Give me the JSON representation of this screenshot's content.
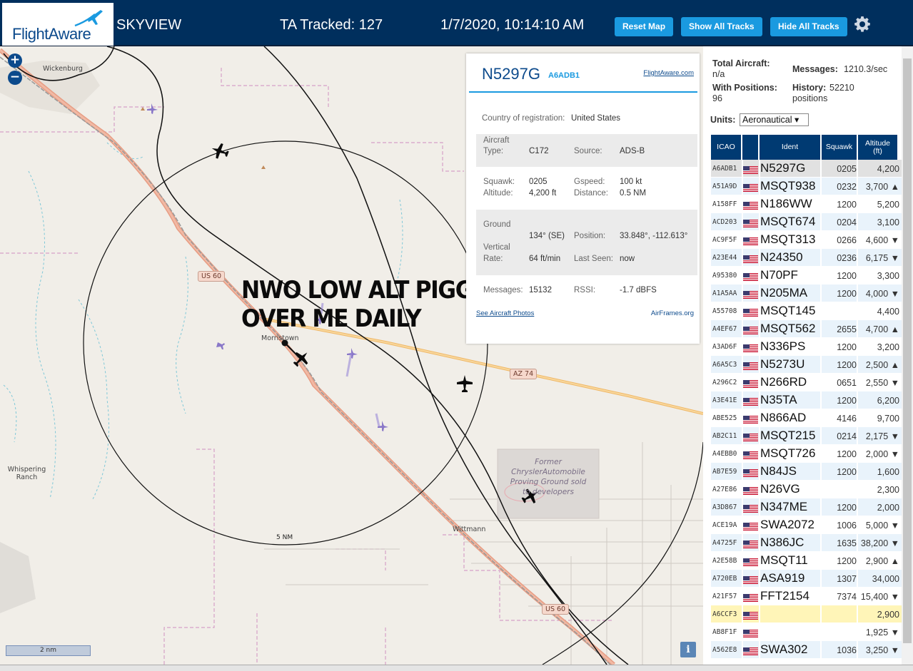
{
  "header": {
    "logo": "FlightAware",
    "site_title": "SKYVIEW",
    "tracked": "TA Tracked: 127",
    "datetime": "1/7/2020, 10:14:10 AM",
    "buttons": {
      "reset": "Reset Map",
      "show": "Show All Tracks",
      "hide": "Hide All Tracks"
    },
    "settings_icon": "gear-icon"
  },
  "map": {
    "zoom_in": "+",
    "zoom_out": "−",
    "places": {
      "wickenburg": "Wickenburg",
      "morristown": "Morristown",
      "whispering": "Whispering Ranch",
      "wittmann": "Wittmann",
      "former": "Former ChryslerAutomobile Proving Ground sold to developers"
    },
    "shields": {
      "us60a": "US 60",
      "us60b": "US 60",
      "az74": "AZ 74"
    },
    "range_label": "5 NM",
    "scale": "2 nm",
    "info": "i",
    "overlay_line1": "NWO LOW ALT PIGGIES",
    "overlay_line2": "OVER ME DAILY"
  },
  "popup": {
    "ident": "N5297G",
    "icao": "A6ADB1",
    "fa_link": "FlightAware.com",
    "country_label": "Country of registration:",
    "country": "United States",
    "aircraft_type_label": "Aircraft Type:",
    "aircraft_type": "C172",
    "source_label": "Source:",
    "source": "ADS-B",
    "squawk_label": "Squawk:",
    "squawk": "0205",
    "gspeed_label": "Gspeed:",
    "gspeed": "100 kt",
    "altitude_label": "Altitude:",
    "altitude": "4,200 ft",
    "distance_label": "Distance:",
    "distance": "0.5 NM",
    "ground_label": "Ground",
    "vertical_label": "Vertical",
    "rate_label": "Rate:",
    "track": "134° (SE)",
    "position_label": "Position:",
    "position": "33.848°, -112.613°",
    "rate": "64 ft/min",
    "lastseen_label": "Last Seen:",
    "lastseen": "now",
    "messages_label": "Messages:",
    "messages": "15132",
    "rssi_label": "RSSI:",
    "rssi": "-1.7 dBFS",
    "photos_link": "See Aircraft Photos",
    "airframes_link": "AirFrames.org"
  },
  "stats": {
    "total_label": "Total Aircraft:",
    "total": "n/a",
    "messages_label": "Messages:",
    "messages": "1210.3/sec",
    "withpos_label": "With Positions:",
    "withpos": "96",
    "history_label": "History:",
    "history": "52210 positions",
    "units_label": "Units:",
    "units_value": "Aeronautical ▾"
  },
  "table": {
    "headers": {
      "icao": "ICAO",
      "ident": "Ident",
      "squawk": "Squawk",
      "altitude": "Altitude (ft)"
    },
    "rows": [
      {
        "icao": "A6ADB1",
        "ident": "N5297G",
        "squawk": "0205",
        "alt": "4,200",
        "style": "sel"
      },
      {
        "icao": "A51A9D",
        "ident": "MSQT938",
        "squawk": "0232",
        "alt": "3,700 ▲",
        "style": "even"
      },
      {
        "icao": "A158FF",
        "ident": "N186WW",
        "squawk": "1200",
        "alt": "5,200",
        "style": "odd"
      },
      {
        "icao": "ACD203",
        "ident": "MSQT674",
        "squawk": "0204",
        "alt": "3,100",
        "style": "even"
      },
      {
        "icao": "AC9F5F",
        "ident": "MSQT313",
        "squawk": "0266",
        "alt": "4,600 ▼",
        "style": "odd"
      },
      {
        "icao": "A23E44",
        "ident": "N24350",
        "squawk": "0236",
        "alt": "6,175 ▼",
        "style": "even"
      },
      {
        "icao": "A95380",
        "ident": "N70PF",
        "squawk": "1200",
        "alt": "3,300",
        "style": "odd"
      },
      {
        "icao": "A1A5AA",
        "ident": "N205MA",
        "squawk": "1200",
        "alt": "4,000 ▼",
        "style": "even"
      },
      {
        "icao": "A55708",
        "ident": "MSQT145",
        "squawk": "",
        "alt": "4,400",
        "style": "odd"
      },
      {
        "icao": "A4EF67",
        "ident": "MSQT562",
        "squawk": "2655",
        "alt": "4,700 ▲",
        "style": "even"
      },
      {
        "icao": "A3AD6F",
        "ident": "N336PS",
        "squawk": "1200",
        "alt": "3,200",
        "style": "odd"
      },
      {
        "icao": "A6A5C3",
        "ident": "N5273U",
        "squawk": "1200",
        "alt": "2,500 ▲",
        "style": "even"
      },
      {
        "icao": "A296C2",
        "ident": "N266RD",
        "squawk": "0651",
        "alt": "2,550 ▼",
        "style": "odd"
      },
      {
        "icao": "A3E41E",
        "ident": "N35TA",
        "squawk": "1200",
        "alt": "6,200",
        "style": "even"
      },
      {
        "icao": "ABE525",
        "ident": "N866AD",
        "squawk": "4146",
        "alt": "9,700",
        "style": "odd"
      },
      {
        "icao": "AB2C11",
        "ident": "MSQT215",
        "squawk": "0214",
        "alt": "2,175 ▼",
        "style": "even"
      },
      {
        "icao": "A4EBB0",
        "ident": "MSQT726",
        "squawk": "1200",
        "alt": "2,000 ▼",
        "style": "odd"
      },
      {
        "icao": "AB7E59",
        "ident": "N84JS",
        "squawk": "1200",
        "alt": "1,600",
        "style": "even"
      },
      {
        "icao": "A27E86",
        "ident": "N26VG",
        "squawk": "",
        "alt": "2,300",
        "style": "odd"
      },
      {
        "icao": "A3D867",
        "ident": "N347ME",
        "squawk": "1200",
        "alt": "2,000",
        "style": "even"
      },
      {
        "icao": "ACE19A",
        "ident": "SWA2072",
        "squawk": "1006",
        "alt": "5,000 ▼",
        "style": "odd"
      },
      {
        "icao": "A4725F",
        "ident": "N386JC",
        "squawk": "1635",
        "alt": "38,200 ▼",
        "style": "even"
      },
      {
        "icao": "A2E58B",
        "ident": "MSQT11",
        "squawk": "1200",
        "alt": "2,900 ▲",
        "style": "odd"
      },
      {
        "icao": "A720EB",
        "ident": "ASA919",
        "squawk": "1307",
        "alt": "34,000",
        "style": "even"
      },
      {
        "icao": "A21F57",
        "ident": "FFT2154",
        "squawk": "7374",
        "alt": "15,400 ▼",
        "style": "odd"
      },
      {
        "icao": "A6CCF3",
        "ident": "",
        "squawk": "",
        "alt": "2,900",
        "style": "hl"
      },
      {
        "icao": "AB8F1F",
        "ident": "",
        "squawk": "",
        "alt": "1,925 ▼",
        "style": "odd"
      },
      {
        "icao": "A562E8",
        "ident": "SWA302",
        "squawk": "1036",
        "alt": "3,250 ▼",
        "style": "even"
      }
    ]
  },
  "colors": {
    "header_bg": "#002f5d",
    "button_bg": "#1a9ae0",
    "table_header_bg": "#003a72",
    "row_alt": "#e9f3fb",
    "row_selected": "#e1e1e1",
    "row_highlight": "#fff5b8"
  }
}
